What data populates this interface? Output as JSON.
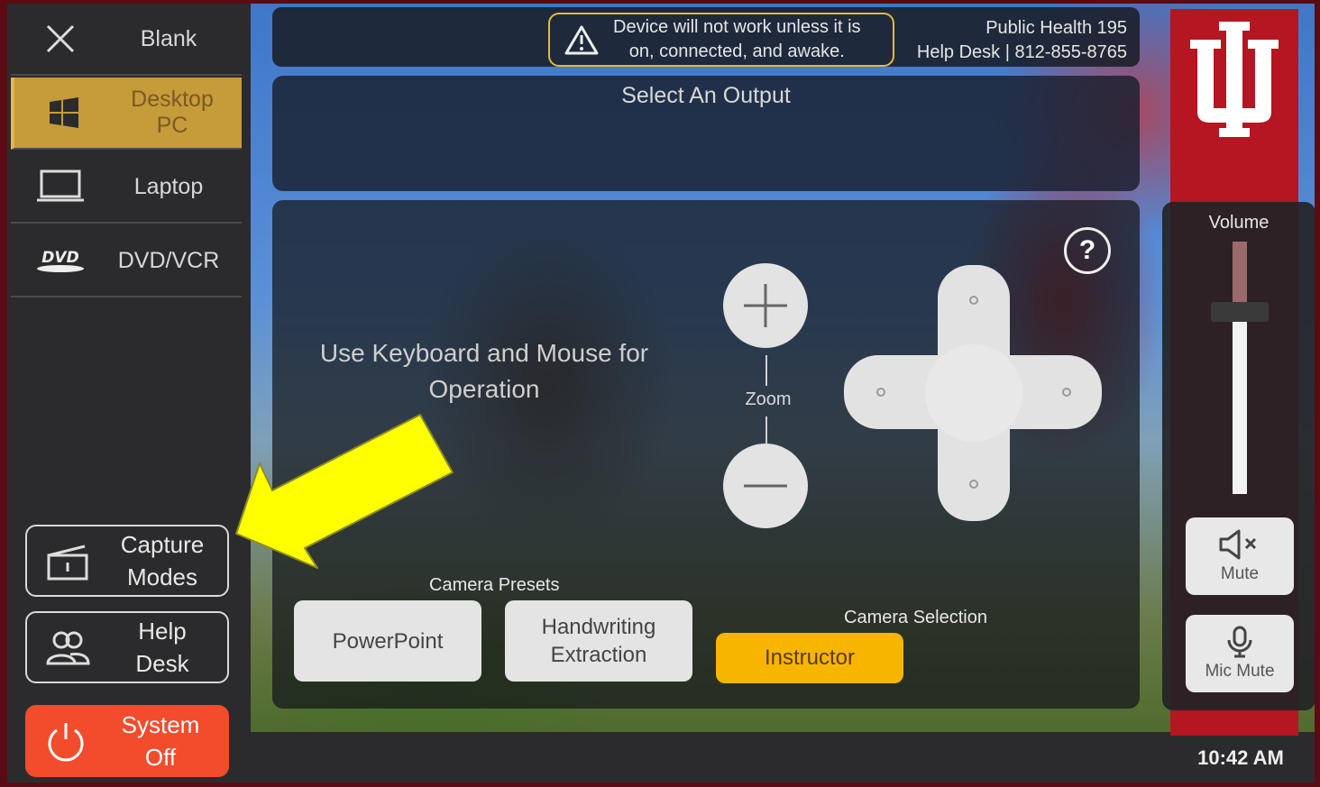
{
  "sources": [
    {
      "label": "Blank",
      "icon": "close-icon",
      "active": false
    },
    {
      "label": "Desktop PC",
      "icon": "windows-icon",
      "active": true
    },
    {
      "label": "Laptop",
      "icon": "laptop-icon",
      "active": false
    },
    {
      "label": "DVD/VCR",
      "icon": "dvd-icon",
      "active": false
    }
  ],
  "sidebar_buttons": {
    "capture": "Capture\nModes",
    "help": "Help\nDesk",
    "power": "System\nOff"
  },
  "header": {
    "warning": "Device will not work unless it is\non, connected, and awake.",
    "room": "Public Health 195",
    "helpdesk": "Help Desk | 812-855-8765"
  },
  "output": {
    "title": "Select An Output"
  },
  "camera": {
    "message": "Use Keyboard and Mouse for\nOperation",
    "help_icon": "?",
    "zoom_label": "Zoom",
    "presets_label": "Camera Presets",
    "presets": [
      "PowerPoint",
      "Handwriting\nExtraction"
    ],
    "selection_label": "Camera Selection",
    "selection": "Instructor"
  },
  "volume": {
    "label": "Volume",
    "level": 0.72
  },
  "audio_buttons": {
    "mute": "Mute",
    "mic_mute": "Mic Mute"
  },
  "clock": "10:42 AM",
  "colors": {
    "brand": "#b51621",
    "accent": "#f7b500",
    "active_source": "#c69b3a",
    "power": "#f24c2c"
  }
}
